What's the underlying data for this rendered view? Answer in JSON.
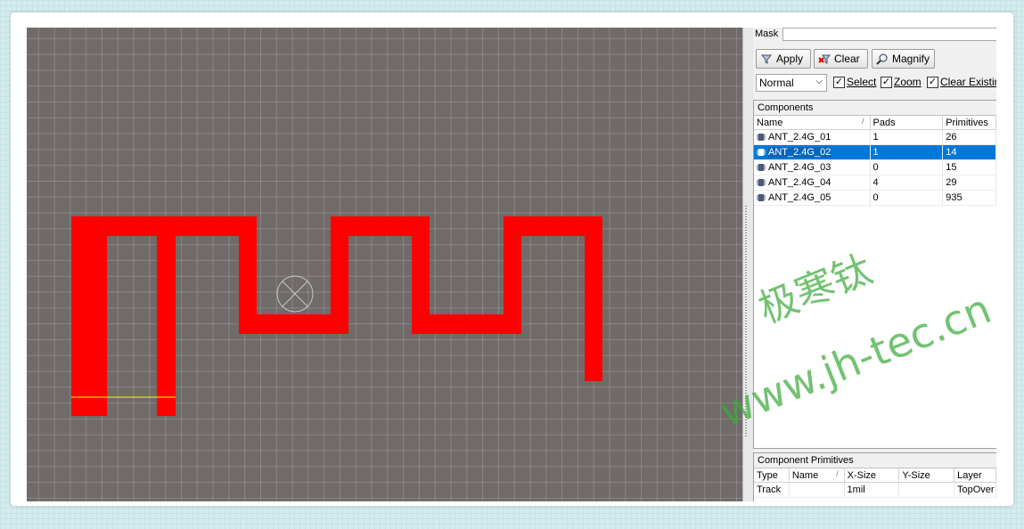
{
  "filter": {
    "mask_label": "Mask",
    "mask_value": "",
    "buttons": {
      "apply": "Apply",
      "clear": "Clear",
      "magnify": "Magnify"
    },
    "mode_selected": "Normal",
    "checkboxes": {
      "select": "Select",
      "zoom": "Zoom",
      "clear_existing": "Clear Existin"
    }
  },
  "components": {
    "title": "Components",
    "columns": [
      "Name",
      "Pads",
      "Primitives"
    ],
    "sort_indicator": "/",
    "rows": [
      {
        "name": "ANT_2.4G_01",
        "pads": "1",
        "primitives": "26",
        "selected": false
      },
      {
        "name": "ANT_2.4G_02",
        "pads": "1",
        "primitives": "14",
        "selected": true
      },
      {
        "name": "ANT_2.4G_03",
        "pads": "0",
        "primitives": "15",
        "selected": false
      },
      {
        "name": "ANT_2.4G_04",
        "pads": "4",
        "primitives": "29",
        "selected": false
      },
      {
        "name": "ANT_2.4G_05",
        "pads": "0",
        "primitives": "935",
        "selected": false
      }
    ]
  },
  "primitives": {
    "title": "Component Primitives",
    "columns": [
      "Type",
      "Name",
      "X-Size",
      "Y-Size",
      "Layer"
    ],
    "sort_indicator": "/",
    "rows": [
      {
        "type": "Track",
        "name": "",
        "x_size": "1mil",
        "y_size": "",
        "layer": "TopOver"
      }
    ]
  },
  "watermark": {
    "cn": "极寒钛",
    "url": "www.jh-tec.cn"
  },
  "colors": {
    "trace": "#ff0000",
    "canvas": "#706a68",
    "selection": "#0078d7",
    "watermark": "#3caa3c"
  },
  "icons": {
    "apply": "funnel-icon",
    "clear": "clear-filter-icon",
    "magnify": "magnifier-icon",
    "component": "chip-icon",
    "origin": "origin-marker-icon"
  }
}
